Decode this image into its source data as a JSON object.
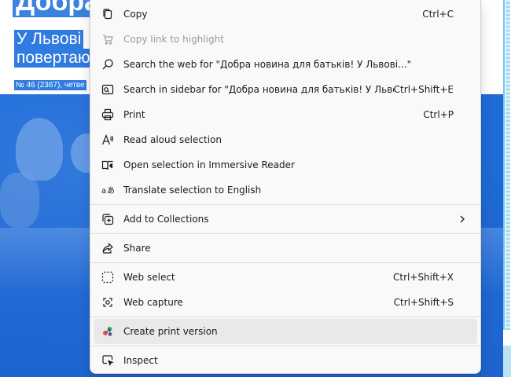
{
  "page": {
    "headline": "Добра",
    "subhead_line1": "У Львові",
    "subhead_line2": "повертаю",
    "issue": "№ 46 (2367), четве"
  },
  "context_menu": {
    "items": [
      {
        "label": "Copy",
        "shortcut": "Ctrl+C",
        "icon": "copy-icon",
        "disabled": false
      },
      {
        "label": "Copy link to highlight",
        "shortcut": "",
        "icon": "link-highlight-icon",
        "disabled": true
      },
      {
        "label": "Search the web for \"Добра новина для батьків! У Львові...\"",
        "shortcut": "",
        "icon": "search-icon",
        "disabled": false
      },
      {
        "label": "Search in sidebar for \"Добра новина для батьків! У Львові...\"",
        "shortcut": "Ctrl+Shift+E",
        "icon": "sidebar-search-icon",
        "disabled": false
      },
      {
        "label": "Print",
        "shortcut": "Ctrl+P",
        "icon": "printer-icon",
        "disabled": false
      },
      {
        "label": "Read aloud selection",
        "shortcut": "",
        "icon": "read-aloud-icon",
        "disabled": false
      },
      {
        "label": "Open selection in Immersive Reader",
        "shortcut": "",
        "icon": "immersive-reader-icon",
        "disabled": false
      },
      {
        "label": "Translate selection to English",
        "shortcut": "",
        "icon": "translate-icon",
        "disabled": false
      },
      {
        "label": "Add to Collections",
        "shortcut": "",
        "icon": "collections-icon",
        "disabled": false,
        "submenu": true
      },
      {
        "label": "Share",
        "shortcut": "",
        "icon": "share-icon",
        "disabled": false
      },
      {
        "label": "Web select",
        "shortcut": "Ctrl+Shift+X",
        "icon": "web-select-icon",
        "disabled": false
      },
      {
        "label": "Web capture",
        "shortcut": "Ctrl+Shift+S",
        "icon": "web-capture-icon",
        "disabled": false
      },
      {
        "label": "Create print version",
        "shortcut": "",
        "icon": "print-version-icon",
        "disabled": false,
        "highlighted": true
      },
      {
        "label": "Inspect",
        "shortcut": "",
        "icon": "inspect-icon",
        "disabled": false
      }
    ]
  },
  "colors": {
    "menu_bg": "#f9f9f9",
    "highlight_bg": "#e9e9e9",
    "selection_blue": "#2f7be0"
  }
}
